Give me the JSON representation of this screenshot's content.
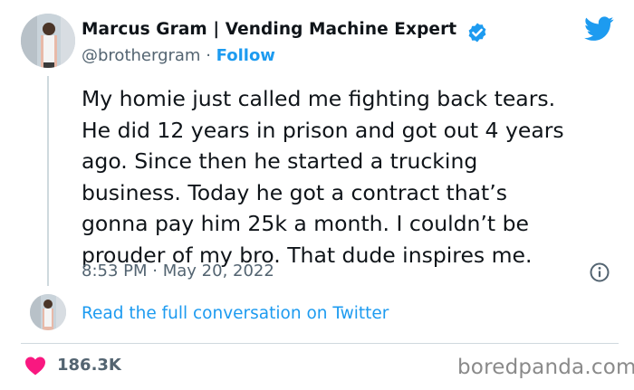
{
  "author": {
    "name": "Marcus Gram | Vending Machine Expert",
    "handle": "@brothergram",
    "separator": "·",
    "follow_label": "Follow"
  },
  "tweet": {
    "lines": [
      "My homie just called me fighting back tears.",
      "He did 12 years in prison and got out 4 years",
      "ago. Since then he started a trucking",
      "business. Today he got a contract that’s",
      "gonna pay him 25k a month. I couldn’t be",
      "prouder of my bro. That dude inspires me."
    ],
    "time": "8:53 PM",
    "separator": "·",
    "date": "May 20, 2022"
  },
  "conversation_link": "Read the full conversation on Twitter",
  "likes": "186.3K",
  "watermark": "boredpanda.com",
  "icons": {
    "verified": "verified-badge-icon",
    "brand": "twitter-bird-icon",
    "info": "info-icon",
    "like": "heart-icon"
  },
  "colors": {
    "accent": "#1d9bf0",
    "heart": "#f91880",
    "secondary_text": "#536471",
    "primary_text": "#0f1419"
  }
}
